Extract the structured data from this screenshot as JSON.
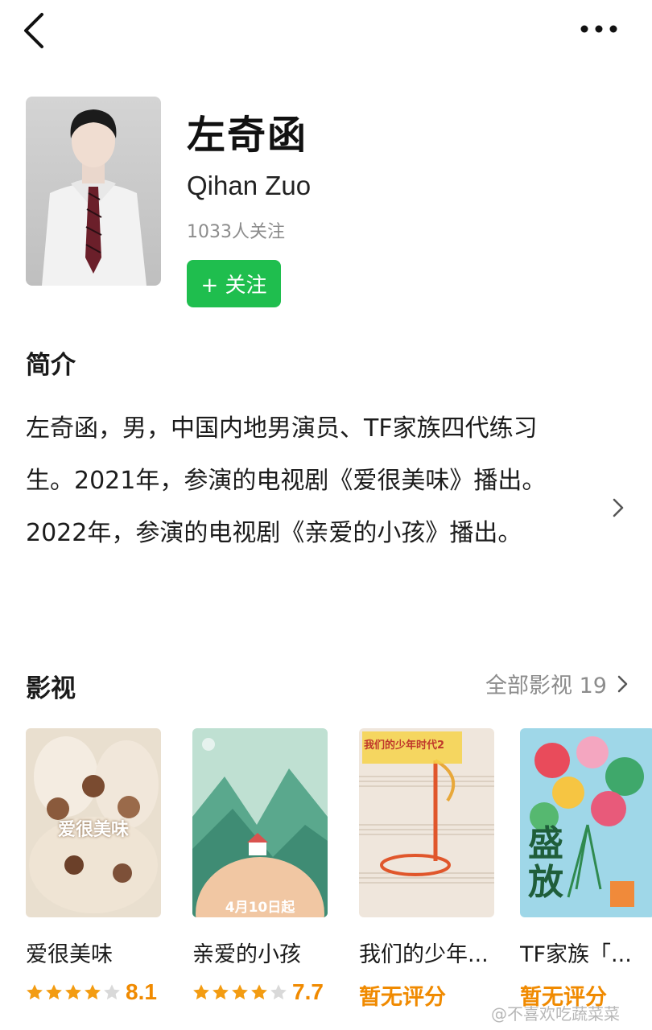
{
  "header": {
    "back_icon": "chevron-left-icon",
    "more_icon": "more-horizontal-icon"
  },
  "profile": {
    "name": "左奇函",
    "name_en": "Qihan Zuo",
    "followers": "1033人关注",
    "follow_label": "+ 关注",
    "follow_color": "#1fbe4e"
  },
  "intro": {
    "title": "简介",
    "text": "左奇函，男，中国内地男演员、TF家族四代练习生。2021年，参演的电视剧《爱很美味》播出。2022年，参演的电视剧《亲爱的小孩》播出。"
  },
  "works": {
    "title": "影视",
    "all_label": "全部影视 19",
    "items": [
      {
        "title": "爱很美味",
        "poster_text": "爱很美味",
        "stars": 4,
        "score": "8.1",
        "no_score": ""
      },
      {
        "title": "亲爱的小孩",
        "poster_text": "4月10日起",
        "stars": 4,
        "score": "7.7",
        "no_score": ""
      },
      {
        "title": "我们的少年...",
        "poster_text": "我们的少年时代2",
        "stars": 0,
        "score": "",
        "no_score": "暂无评分"
      },
      {
        "title": "TF家族「...",
        "poster_text": "盛放",
        "stars": 0,
        "score": "",
        "no_score": "暂无评分"
      }
    ],
    "star_color": "#f39c12",
    "star_empty_color": "#d9d9d9"
  },
  "watermark": "@不喜欢吃蔬菜菜"
}
